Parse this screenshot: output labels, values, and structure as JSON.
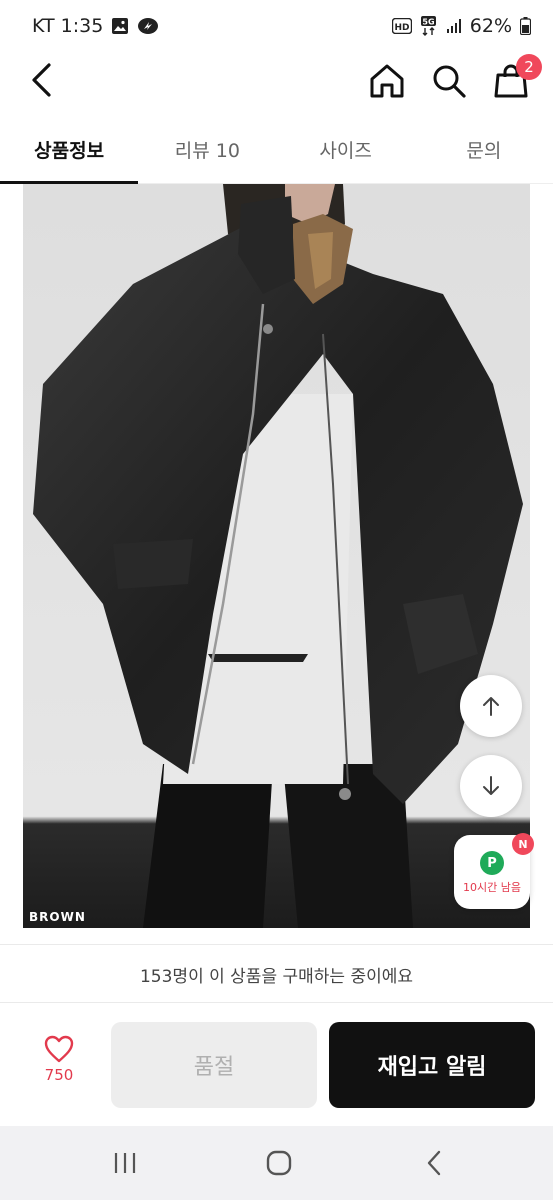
{
  "status_bar": {
    "carrier_time": "KT 1:35",
    "battery": "62%",
    "network_hd": "HD",
    "network_5g": "5G"
  },
  "header": {
    "icons": [
      "back-arrow-icon",
      "home-icon",
      "search-icon",
      "cart-icon"
    ],
    "cart_count": "2"
  },
  "tabs": [
    {
      "label": "상품정보",
      "active": true
    },
    {
      "label": "리뷰 10",
      "active": false
    },
    {
      "label": "사이즈",
      "active": false
    },
    {
      "label": "문의",
      "active": false
    }
  ],
  "product_image": {
    "color_label": "BROWN"
  },
  "floating": {
    "point_letter": "P",
    "point_text": "10시간 남음",
    "new_badge": "N"
  },
  "buying_info": "153명이 이 상품을 구매하는 중이에요",
  "action_bar": {
    "like_count": "750",
    "soldout_label": "품절",
    "restock_label": "재입고 알림"
  },
  "colors": {
    "accent": "#f0485b",
    "primary_button": "#111111",
    "point_green": "#1faa59"
  }
}
